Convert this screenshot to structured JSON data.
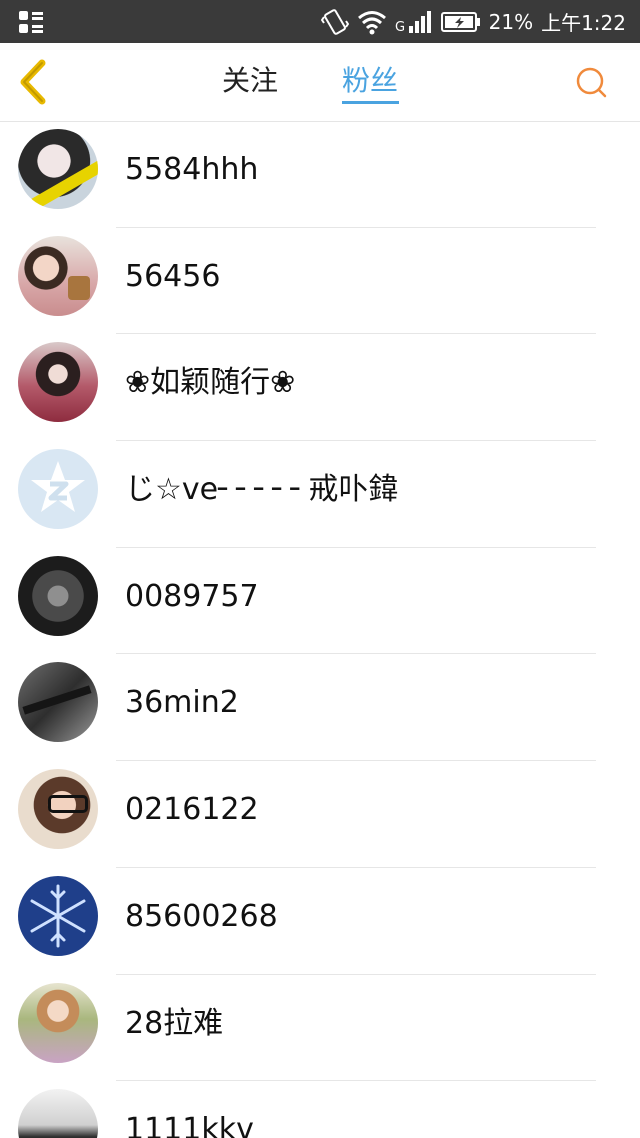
{
  "status_bar": {
    "battery": "21%",
    "time": "上午1:22",
    "network": "G"
  },
  "header": {
    "tab_follow": "关注",
    "tab_fans": "粉丝",
    "active_tab": "粉丝"
  },
  "colors": {
    "accent": "#4aa3e0",
    "back_arrow": "#e8b900",
    "search_icon": "#f08a3c",
    "status_bar": "#3a3a3a"
  },
  "fans": [
    {
      "name": "5584hhh"
    },
    {
      "name": "56456"
    },
    {
      "name": "❀如颖随行❀"
    },
    {
      "name": "じ☆ve╴╴╴╴╴戒卟鍏"
    },
    {
      "name": "0089757"
    },
    {
      "name": "36min2"
    },
    {
      "name": "0216122"
    },
    {
      "name": "85600268"
    },
    {
      "name": "28拉难"
    },
    {
      "name": "1111kkv"
    }
  ]
}
